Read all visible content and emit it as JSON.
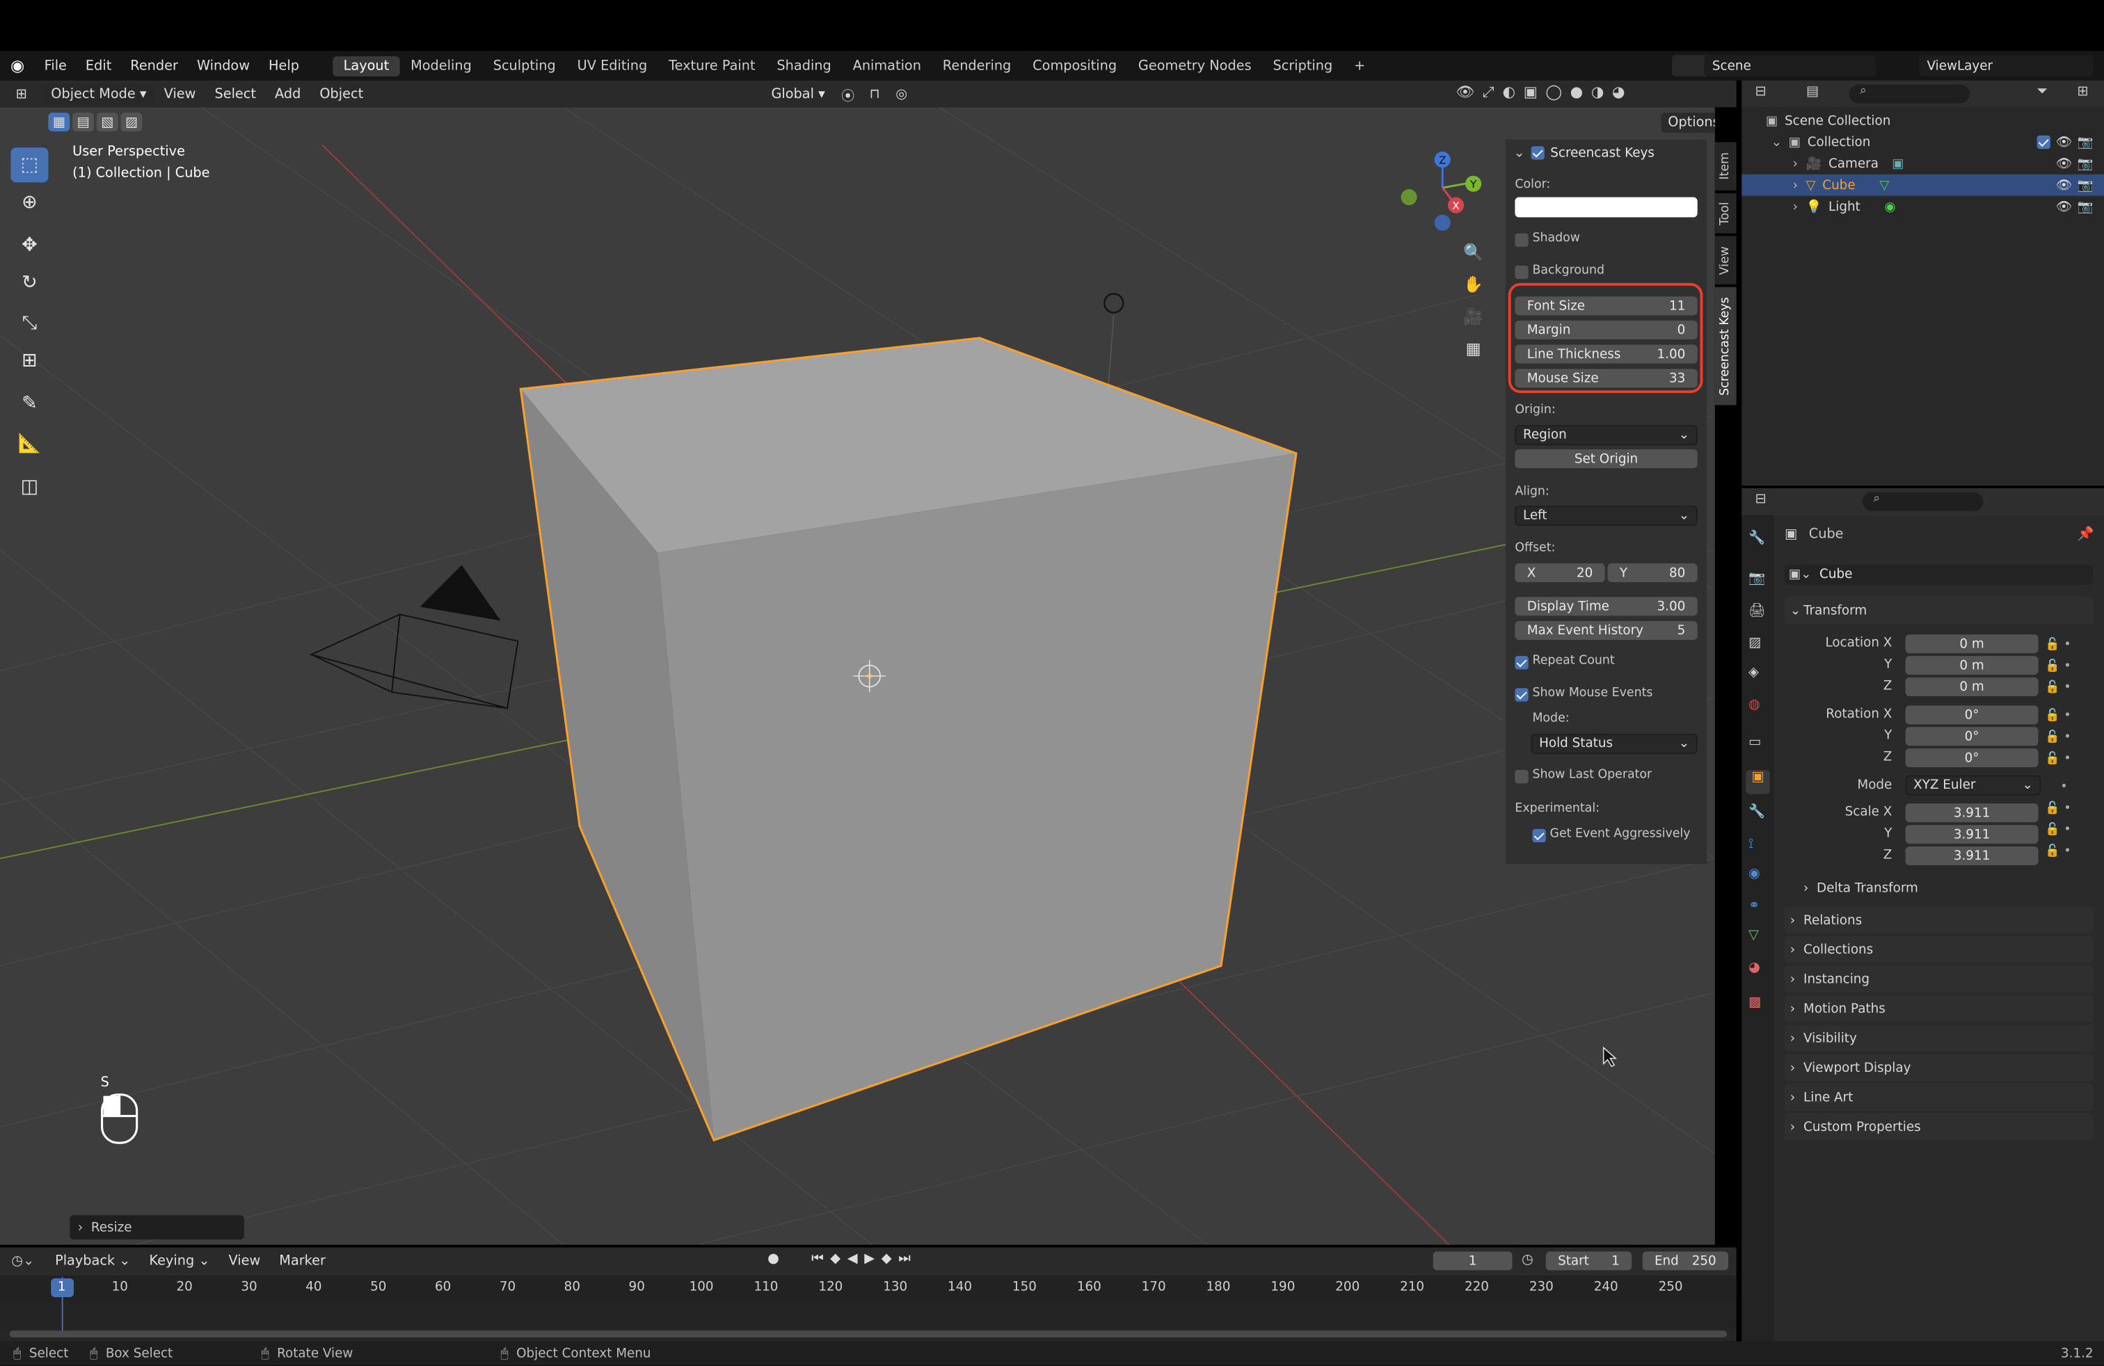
{
  "menu": {
    "items": [
      "File",
      "Edit",
      "Render",
      "Window",
      "Help"
    ]
  },
  "workspaces": [
    "Layout",
    "Modeling",
    "Sculpting",
    "UV Editing",
    "Texture Paint",
    "Shading",
    "Animation",
    "Rendering",
    "Compositing",
    "Geometry Nodes",
    "Scripting"
  ],
  "workspace_add": "+",
  "scene": {
    "label": "Scene",
    "view_layer": "ViewLayer"
  },
  "viewport_header": {
    "mode": "Object Mode",
    "menus": [
      "View",
      "Select",
      "Add",
      "Object"
    ],
    "transform_orientation": "Global",
    "options": "Options"
  },
  "viewport": {
    "perspective": "User Perspective",
    "collection_info": "(1) Collection | Cube",
    "mouse_key": "S",
    "last_op": "Resize"
  },
  "gizmo": {
    "x": "X",
    "y": "Y",
    "z": "Z"
  },
  "screencast": {
    "title": "Screencast Keys",
    "color_label": "Color:",
    "shadow": "Shadow",
    "background": "Background",
    "fields": [
      {
        "label": "Font Size",
        "value": "11"
      },
      {
        "label": "Margin",
        "value": "0"
      },
      {
        "label": "Line Thickness",
        "value": "1.00"
      },
      {
        "label": "Mouse Size",
        "value": "33"
      }
    ],
    "origin_label": "Origin:",
    "origin_value": "Region",
    "set_origin": "Set Origin",
    "align_label": "Align:",
    "align_value": "Left",
    "offset_label": "Offset:",
    "offset_x_label": "X",
    "offset_x": "20",
    "offset_y_label": "Y",
    "offset_y": "80",
    "display_time_label": "Display Time",
    "display_time": "3.00",
    "max_event_label": "Max Event History",
    "max_event": "5",
    "repeat_count": "Repeat Count",
    "show_mouse": "Show Mouse Events",
    "mode_label": "Mode:",
    "mode_value": "Hold Status",
    "show_last_op": "Show Last Operator",
    "experimental": "Experimental:",
    "get_event": "Get Event Aggressively"
  },
  "sidebar_tabs": [
    "Item",
    "Tool",
    "View",
    "Screencast Keys"
  ],
  "outliner": {
    "root": "Scene Collection",
    "collection": "Collection",
    "items": [
      "Camera",
      "Cube",
      "Light"
    ]
  },
  "properties": {
    "object_name": "Cube",
    "data_name": "Cube",
    "transform": "Transform",
    "location_label": "Location X",
    "rotation_label": "Rotation X",
    "scale_label": "Scale X",
    "y": "Y",
    "z": "Z",
    "location": [
      "0 m",
      "0 m",
      "0 m"
    ],
    "rotation": [
      "0°",
      "0°",
      "0°"
    ],
    "mode_label": "Mode",
    "mode_value": "XYZ Euler",
    "scale": [
      "3.911",
      "3.911",
      "3.911"
    ],
    "delta": "Delta Transform",
    "sections": [
      "Relations",
      "Collections",
      "Instancing",
      "Motion Paths",
      "Visibility",
      "Viewport Display",
      "Line Art",
      "Custom Properties"
    ]
  },
  "timeline": {
    "menus": [
      "Playback",
      "Keying",
      "View",
      "Marker"
    ],
    "current_frame": "1",
    "start_label": "Start",
    "start": "1",
    "end_label": "End",
    "end": "250",
    "ticks": [
      "1",
      "10",
      "20",
      "30",
      "40",
      "50",
      "60",
      "70",
      "80",
      "90",
      "100",
      "110",
      "120",
      "130",
      "140",
      "150",
      "160",
      "170",
      "180",
      "190",
      "200",
      "210",
      "220",
      "230",
      "240",
      "250"
    ]
  },
  "statusbar": {
    "select": "Select",
    "box_select": "Box Select",
    "rotate": "Rotate View",
    "context": "Object Context Menu",
    "version": "3.1.2"
  },
  "colors": {
    "accent": "#4772b3",
    "selection_orange": "#f5a030",
    "highlight_red": "#e8402a"
  }
}
